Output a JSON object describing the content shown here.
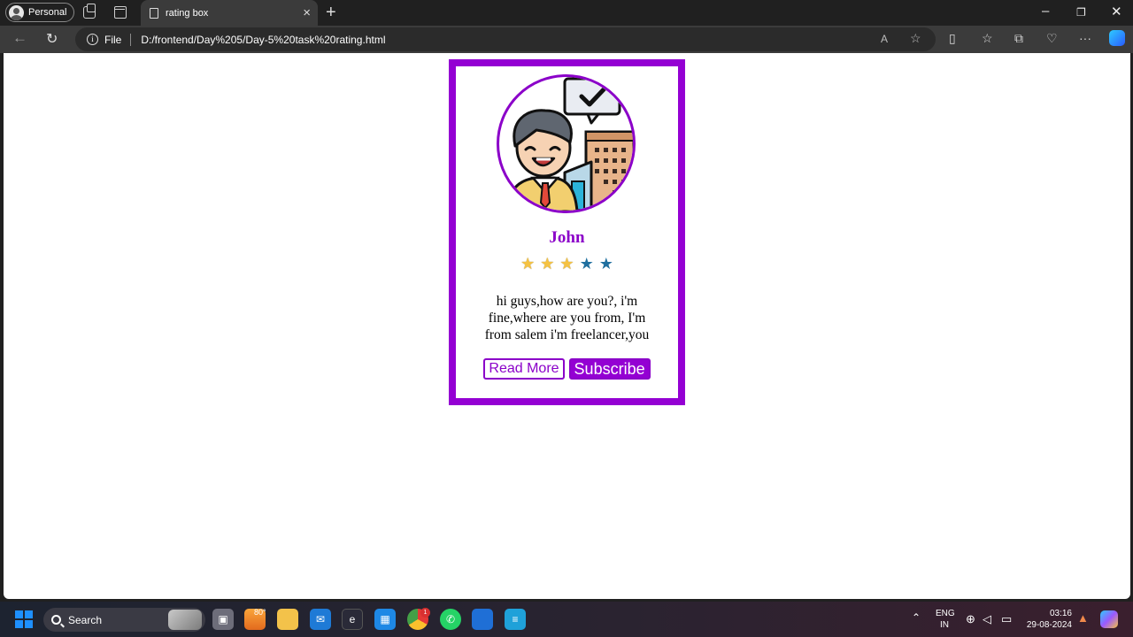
{
  "browser": {
    "profile_label": "Personal",
    "tab_title": "rating box",
    "address_scheme": "File",
    "address_url": "D:/frontend/Day%205/Day-5%20task%20rating.html"
  },
  "card": {
    "name": "John",
    "rating": 3,
    "rating_max": 5,
    "message": "hi guys,how are you?, i'm fine,where are you from, I'm from salem i'm freelancer,you",
    "read_more_label": "Read More",
    "subscribe_label": "Subscribe",
    "accent_color": "#9400d3"
  },
  "taskbar": {
    "search_label": "Search",
    "weather_temp": "80°",
    "chrome_badge": "1",
    "language_line1": "ENG",
    "language_line2": "IN",
    "time": "03:16",
    "date": "29-08-2024"
  }
}
